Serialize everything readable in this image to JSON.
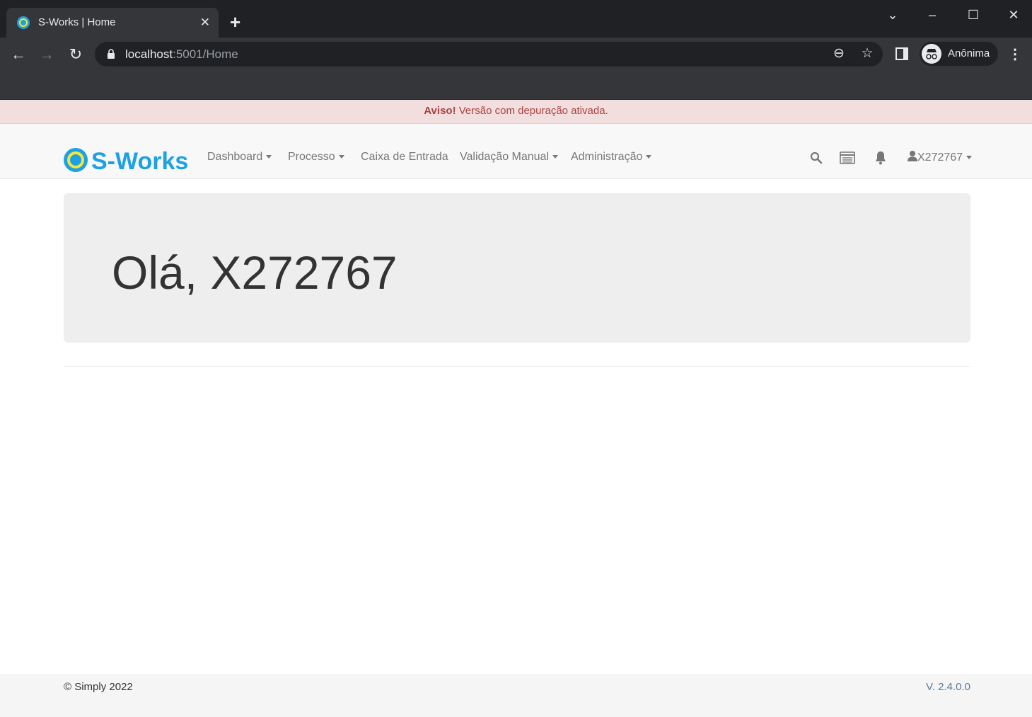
{
  "browser": {
    "tab": {
      "title": "S-Works | Home"
    },
    "new_tab_label": "+",
    "address": {
      "host": "localhost",
      "rest": ":5001/Home"
    },
    "profile": {
      "name": "Anônima"
    }
  },
  "alert": {
    "strong": "Aviso!",
    "message": " Versão com depuração ativada."
  },
  "navbar": {
    "brand": "S-Works",
    "items": [
      {
        "label": "Dashboard",
        "dropdown": true
      },
      {
        "label": "Processo",
        "dropdown": true
      },
      {
        "label": "Caixa de Entrada",
        "dropdown": false
      },
      {
        "label": "Validação Manual",
        "dropdown": true
      },
      {
        "label": "Administração",
        "dropdown": true
      }
    ],
    "user": "X272767"
  },
  "jumbotron": {
    "greeting": "Olá, X272767"
  },
  "footer": {
    "copyright": "© Simply 2022",
    "version": "V. 2.4.0.0"
  },
  "colors": {
    "brand": "#1da1e2",
    "alert_text": "#a94442",
    "alert_bg": "#f2dede"
  }
}
